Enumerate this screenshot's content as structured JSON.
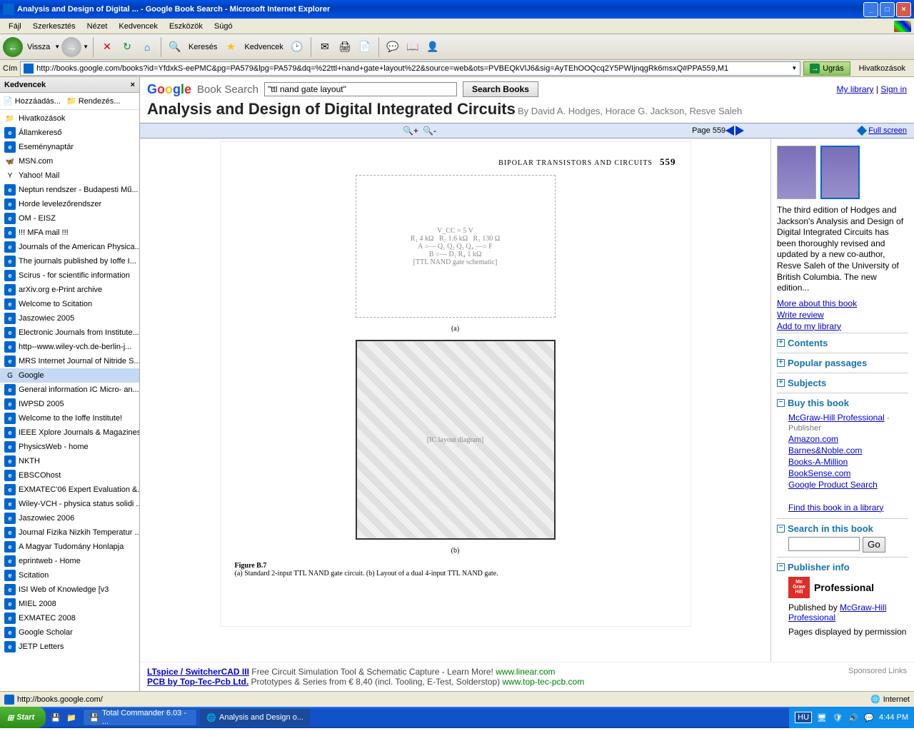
{
  "window": {
    "title": "Analysis and Design of Digital ... - Google Book Search - Microsoft Internet Explorer",
    "min": "_",
    "max": "□",
    "close": "×"
  },
  "menu": {
    "file": "Fájl",
    "edit": "Szerkesztés",
    "view": "Nézet",
    "favorites": "Kedvencek",
    "tools": "Eszközök",
    "help": "Súgó"
  },
  "toolbar": {
    "back": "Vissza",
    "search": "Keresés",
    "favorites": "Kedvencek"
  },
  "address": {
    "label": "Cím",
    "url": "http://books.google.com/books?id=YfdxkS-eePMC&pg=PA579&lpg=PA579&dq=%22ttl+nand+gate+layout%22&source=web&ots=PVBEQkVlJ6&sig=AyTEhOOQcq2Y5PWIjnqgRk6msxQ#PPA559,M1",
    "go": "Ugrás",
    "links": "Hivatkozások"
  },
  "favpanel": {
    "title": "Kedvencek",
    "add": "Hozzáadás...",
    "organize": "Rendezés..."
  },
  "favorites": [
    {
      "icon": "folder",
      "label": "Hivatkozások"
    },
    {
      "icon": "e",
      "label": "Államkereső"
    },
    {
      "icon": "e",
      "label": "Eseménynaptár"
    },
    {
      "icon": "msn",
      "label": "MSN.com"
    },
    {
      "icon": "y",
      "label": "Yahoo! Mail"
    },
    {
      "icon": "e",
      "label": "Neptun rendszer - Budapesti Mű..."
    },
    {
      "icon": "e",
      "label": "Horde levelezőrendszer"
    },
    {
      "icon": "e",
      "label": "OM - EISZ"
    },
    {
      "icon": "e",
      "label": "!!! MFA mail !!!"
    },
    {
      "icon": "e",
      "label": "Journals of the American Physica..."
    },
    {
      "icon": "e",
      "label": "The journals published by Ioffe I..."
    },
    {
      "icon": "e",
      "label": "Scirus - for scientific information"
    },
    {
      "icon": "e",
      "label": "arXiv.org e-Print archive"
    },
    {
      "icon": "e",
      "label": "Welcome to Scitation"
    },
    {
      "icon": "e",
      "label": "Jaszowiec 2005"
    },
    {
      "icon": "e",
      "label": "Electronic Journals from Institute..."
    },
    {
      "icon": "e",
      "label": "http--www.wiley-vch.de-berlin-j..."
    },
    {
      "icon": "e",
      "label": "MRS Internet Journal of Nitride S..."
    },
    {
      "icon": "g",
      "label": "Google",
      "selected": true
    },
    {
      "icon": "e",
      "label": "General information  IC Micro- an..."
    },
    {
      "icon": "e",
      "label": "IWPSD 2005"
    },
    {
      "icon": "e",
      "label": "Welcome to the Ioffe Institute!"
    },
    {
      "icon": "e",
      "label": "IEEE Xplore Journals & Magazines"
    },
    {
      "icon": "e",
      "label": "PhysicsWeb - home"
    },
    {
      "icon": "e",
      "label": "NKTH"
    },
    {
      "icon": "e",
      "label": "EBSCOhost"
    },
    {
      "icon": "e",
      "label": "EXMATEC'06 Expert Evaluation &..."
    },
    {
      "icon": "e",
      "label": "Wiley-VCH - physica status solidi ..."
    },
    {
      "icon": "e",
      "label": "Jaszowiec 2006"
    },
    {
      "icon": "e",
      "label": "Journal Fizika Nizkih Temperatur ..."
    },
    {
      "icon": "e",
      "label": "A Magyar Tudomány Honlapja"
    },
    {
      "icon": "e",
      "label": "eprintweb - Home"
    },
    {
      "icon": "e",
      "label": "Scitation"
    },
    {
      "icon": "e",
      "label": "ISI Web of Knowledge [v3"
    },
    {
      "icon": "e",
      "label": "MIEL 2008"
    },
    {
      "icon": "e",
      "label": "EXMATEC 2008"
    },
    {
      "icon": "e",
      "label": "Google Scholar"
    },
    {
      "icon": "e",
      "label": "JETP Letters"
    }
  ],
  "gb": {
    "brand": "Book Search",
    "query": "\"ttl nand gate layout\"",
    "searchbtn": "Search Books",
    "mylibrary": "My library",
    "signin": "Sign in",
    "title": "Analysis and Design of Digital Integrated Circuits",
    "authors": " By David A. Hodges, Horace G. Jackson, Resve Saleh",
    "page": "Page 559",
    "fullscreen": "Full screen"
  },
  "page": {
    "header": "BIPOLAR TRANSISTORS AND CIRCUITS",
    "number": "559",
    "vcc": "V_CC = 5 V",
    "r1": "R₁ 4 kΩ",
    "r2": "R₂ 1.6 kΩ",
    "r3": "R₃ 130 Ω",
    "r4": "R₄ 1 kΩ",
    "qa": "(a)",
    "qb": "(b)",
    "fignum": "Figure B.7",
    "figtext": "(a) Standard 2-input TTL NAND gate circuit. (b) Layout of a dual 4-input TTL NAND gate."
  },
  "right": {
    "desc": "The third edition of Hodges and Jackson's Analysis and Design of Digital Integrated Circuits has been thoroughly revised and updated by a new co-author, Resve Saleh of the University of British Columbia. The new edition...",
    "more": "More about this book",
    "review": "Write review",
    "addlib": "Add to my library",
    "contents": "Contents",
    "popular": "Popular passages",
    "subjects": "Subjects",
    "buy": "Buy this book",
    "mcgraw": "McGraw-Hill Professional",
    "publisher": " - Publisher",
    "amazon": "Amazon.com",
    "bn": "Barnes&Noble.com",
    "bam": "Books-A-Million",
    "bs": "BookSense.com",
    "gps": "Google Product Search",
    "findlib": "Find this book in a library",
    "searchin": "Search in this book",
    "go": "Go",
    "pubinfo": "Publisher info",
    "mcgh1": "Mc",
    "mcgh2": "Graw",
    "mcgh3": "Hill",
    "prof": "Professional",
    "pubby": "Published by ",
    "mcghlink": "McGraw-Hill Professional",
    "perm": "Pages displayed by permission"
  },
  "sponsored": {
    "label": "Sponsored Links",
    "ad1_title": "LTspice / SwitcherCAD III",
    "ad1_text": " Free Circuit Simulation Tool & Schematic Capture - Learn More! ",
    "ad1_url": "www.linear.com",
    "ad2_title": "PCB by Top-Tec-Pcb Ltd.",
    "ad2_text": " Prototypes & Series from € 8,40 (incl. Tooling, E-Test, Solderstop) ",
    "ad2_url": "www.top-tec-pcb.com"
  },
  "status": {
    "text": "http://books.google.com/",
    "zone": "Internet"
  },
  "taskbar": {
    "start": "Start",
    "task1": "Total Commander 6.03 - ...",
    "task2": "Analysis and Design o...",
    "lang": "HU",
    "time": "4:44 PM"
  }
}
